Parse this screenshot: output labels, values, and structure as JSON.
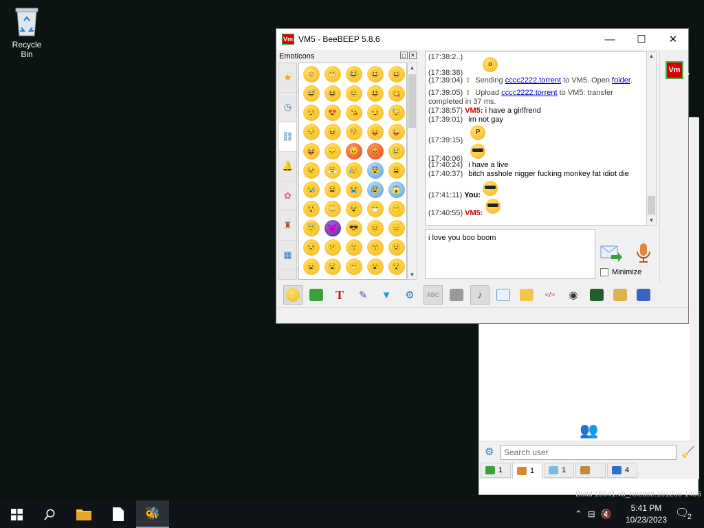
{
  "desktop": {
    "recycle_bin_label": "Recycle Bin",
    "build_watermark": "Build 19041.vb_release.191206-1406"
  },
  "window": {
    "title": "VM5 - BeeBEEP 5.8.6",
    "app_logo": "Vm",
    "buttons": {
      "minimize": "—",
      "maximize": "☐",
      "close": "✕"
    }
  },
  "emoticons_panel": {
    "title": "Emoticons",
    "categories": [
      "star-icon",
      "clock-icon",
      "link-icon",
      "bell-icon",
      "flower-icon",
      "object-icon",
      "symbol-icon"
    ],
    "grid": [
      "☺",
      "😁",
      "😂",
      "😀",
      "😄",
      "😅",
      "😆",
      "😊",
      "😃",
      "😋",
      "😌",
      "😍",
      "😘",
      "😏",
      "😓",
      "😔",
      "😖",
      "😚",
      "😛",
      "😜",
      "😝",
      "😞",
      "😠",
      "😡",
      "😢",
      "😣",
      "😤",
      "😥",
      "😨",
      "😩",
      "😪",
      "😫",
      "😭",
      "😰",
      "😱",
      "😲",
      "😳",
      "😵",
      "😷",
      "😶",
      "😇",
      "😈",
      "😎",
      "😐",
      "😑",
      "😒",
      "😕",
      "😗",
      "😙",
      "😟",
      "😦",
      "😧",
      "😬",
      "😮",
      "😯"
    ]
  },
  "chat": {
    "messages": [
      {
        "ts": "(17:38:38)",
        "kind": "emoji",
        "emoji": "😮"
      },
      {
        "ts": "(17:39:04)",
        "kind": "system",
        "prefix": "Sending ",
        "link": "cccc2222.torrent",
        "middle": " to VM5. Open ",
        "link2": "folder",
        "suffix": "."
      },
      {
        "ts": "(17:39:05)",
        "kind": "system",
        "prefix": "Upload ",
        "link": "cccc2222.torrent",
        "middle": " to VM5: transfer",
        "link2": "",
        "suffix": ""
      },
      {
        "ts": "",
        "kind": "continuation",
        "text": "completed in 37 ms."
      },
      {
        "ts": "(17:38:57)",
        "kind": "text",
        "who": "VM5:",
        "text": "i have a girlfrend"
      },
      {
        "ts": "(17:39:01)",
        "kind": "text",
        "who": "",
        "text": "im not gay"
      },
      {
        "ts": "(17:39:15)",
        "kind": "emoji",
        "emoji": "😛"
      },
      {
        "ts": "(17:40:06)",
        "kind": "emoji",
        "emoji": "😎"
      },
      {
        "ts": "(17:40:24)",
        "kind": "text",
        "who": "",
        "text": "i have a live"
      },
      {
        "ts": "(17:40:37)",
        "kind": "text",
        "who": "",
        "text": "bitch asshole nigger fucking monkey fat idiot die"
      },
      {
        "ts": "(17:41:11)",
        "kind": "emoji_who",
        "who": "You:",
        "emoji": "😎"
      },
      {
        "ts": "(17:40:55)",
        "kind": "emoji_who",
        "who": "VM5:",
        "emoji": "😎"
      }
    ],
    "input_value": "i love you boo boom",
    "minimize_label": "Minimize"
  },
  "toolbar": [
    "emoticons-icon",
    "download-icon",
    "font-icon",
    "color-icon",
    "filter-icon",
    "settings-icon",
    "spellcheck-icon",
    "dictionary-icon",
    "note-icon",
    "send-file-icon",
    "send-folder-icon",
    "code-icon",
    "screenshot-icon",
    "terminal-icon",
    "edit-icon",
    "save-icon"
  ],
  "user_window": {
    "search_placeholder": "Search user",
    "tabs": [
      {
        "icon": "chat-tab-icon",
        "count": "1"
      },
      {
        "icon": "users-tab-icon",
        "count": "1"
      },
      {
        "icon": "messages-tab-icon",
        "count": "1"
      },
      {
        "icon": "groups-tab-icon",
        "count": ""
      },
      {
        "icon": "shares-tab-icon",
        "count": "4"
      }
    ]
  },
  "taskbar": {
    "time": "5:41 PM",
    "date": "10/23/2023",
    "notifications": "2"
  },
  "colors": {
    "desktop": "#0b1410",
    "accent_red": "#cc0000",
    "link_blue": "#0000cc"
  }
}
